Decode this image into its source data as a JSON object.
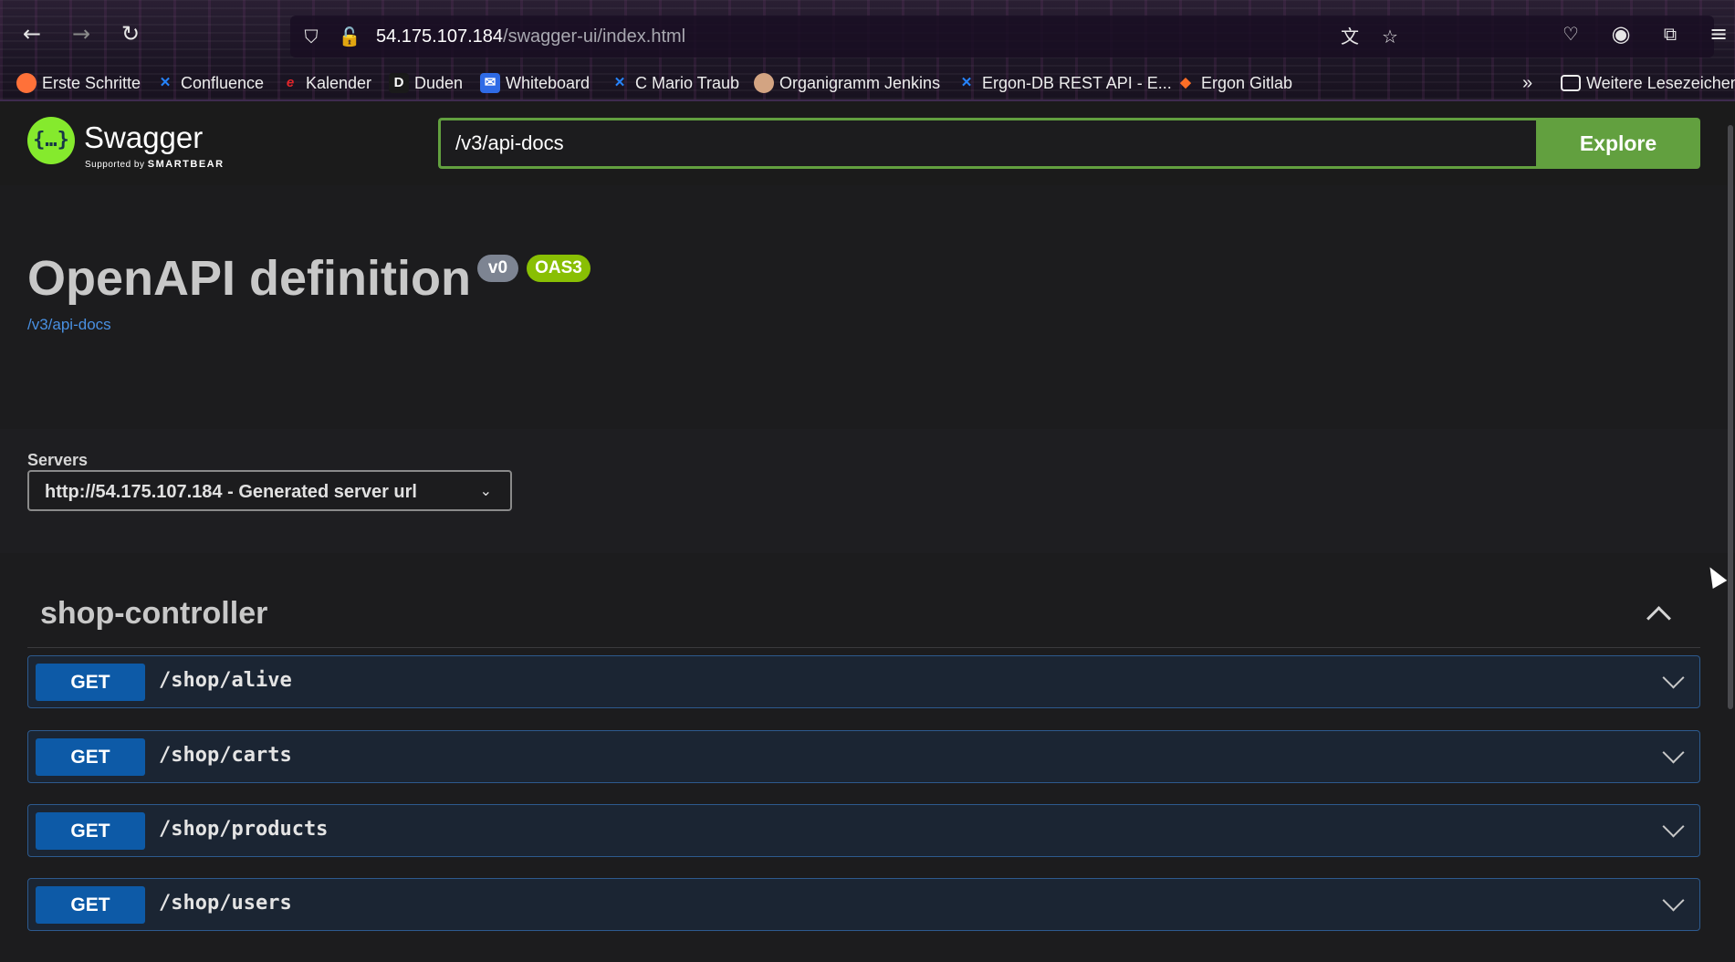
{
  "browser": {
    "url_host": "54.175.107.184",
    "url_path": "/swagger-ui/index.html",
    "bookmarks": [
      {
        "label": "Erste Schritte",
        "icon": "firefox-icon",
        "color": "#ff7139"
      },
      {
        "label": "Confluence",
        "icon": "confluence-icon",
        "color": "#2684ff"
      },
      {
        "label": "Kalender",
        "icon": "calendar-e-icon",
        "color": "#e3262b"
      },
      {
        "label": "Duden",
        "icon": "duden-icon",
        "color": "#1a1a1a"
      },
      {
        "label": "Whiteboard",
        "icon": "whiteboard-icon",
        "color": "#2f6be6"
      },
      {
        "label": "C Mario Traub",
        "icon": "confluence-icon",
        "color": "#2684ff"
      },
      {
        "label": "Organigramm Jenkins",
        "icon": "jenkins-icon",
        "color": "#d3a482"
      },
      {
        "label": "Ergon-DB REST API - E...",
        "icon": "confluence-icon",
        "color": "#2684ff"
      },
      {
        "label": "Ergon Gitlab",
        "icon": "gitlab-icon",
        "color": "#fc6d26"
      },
      {
        "label": "Weitere Lesezeichen",
        "icon": "folder-icon",
        "color": "#ededed"
      }
    ]
  },
  "topbar": {
    "logo_name": "Swagger",
    "logo_supported": "Supported by",
    "logo_brand": "SMARTBEAR",
    "spec_url": "/v3/api-docs",
    "explore_label": "Explore",
    "accent_color": "#62a03f"
  },
  "info": {
    "title": "OpenAPI definition",
    "version": "v0",
    "oas": "OAS3",
    "link": "/v3/api-docs"
  },
  "servers": {
    "label": "Servers",
    "selected": "http://54.175.107.184 - Generated server url"
  },
  "tag": {
    "name": "shop-controller",
    "operations": [
      {
        "method": "GET",
        "path": "/shop/alive"
      },
      {
        "method": "GET",
        "path": "/shop/carts"
      },
      {
        "method": "GET",
        "path": "/shop/products"
      },
      {
        "method": "GET",
        "path": "/shop/users"
      }
    ]
  }
}
